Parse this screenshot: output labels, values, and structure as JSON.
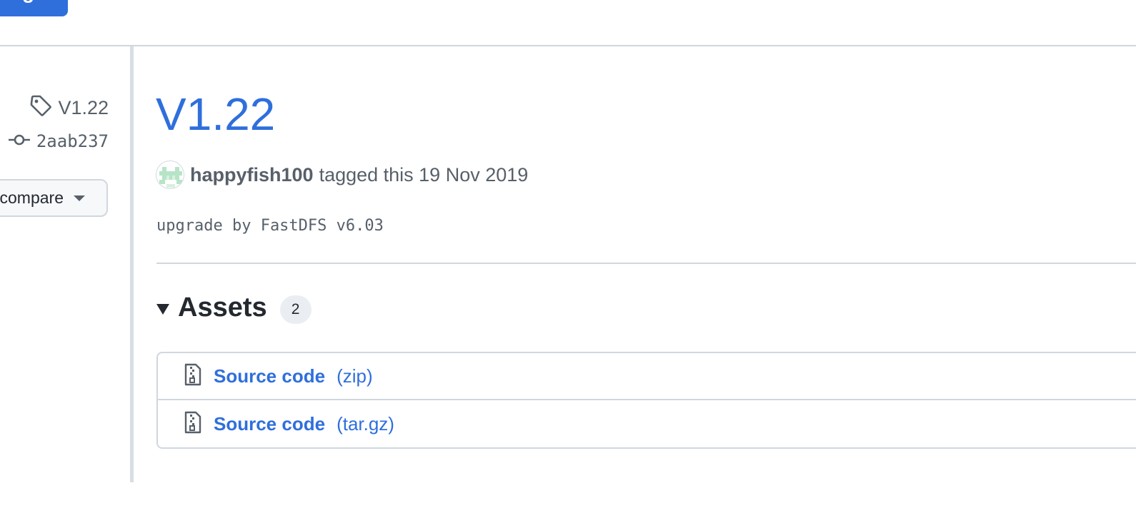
{
  "header": {
    "top_button_label": "ige"
  },
  "sidebar": {
    "tag": "V1.22",
    "commit": "2aab237",
    "compare_label": "compare"
  },
  "release": {
    "title": "V1.22",
    "author": "happyfish100",
    "tagged_text": "tagged this 19 Nov 2019",
    "body": "upgrade by FastDFS v6.03"
  },
  "assets": {
    "title": "Assets",
    "count": "2",
    "items": [
      {
        "name": "Source code",
        "ext": "(zip)"
      },
      {
        "name": "Source code",
        "ext": "(tar.gz)"
      }
    ]
  },
  "colors": {
    "accent": "#2f6fdc",
    "muted": "#57606a",
    "border": "#d0d7de"
  }
}
